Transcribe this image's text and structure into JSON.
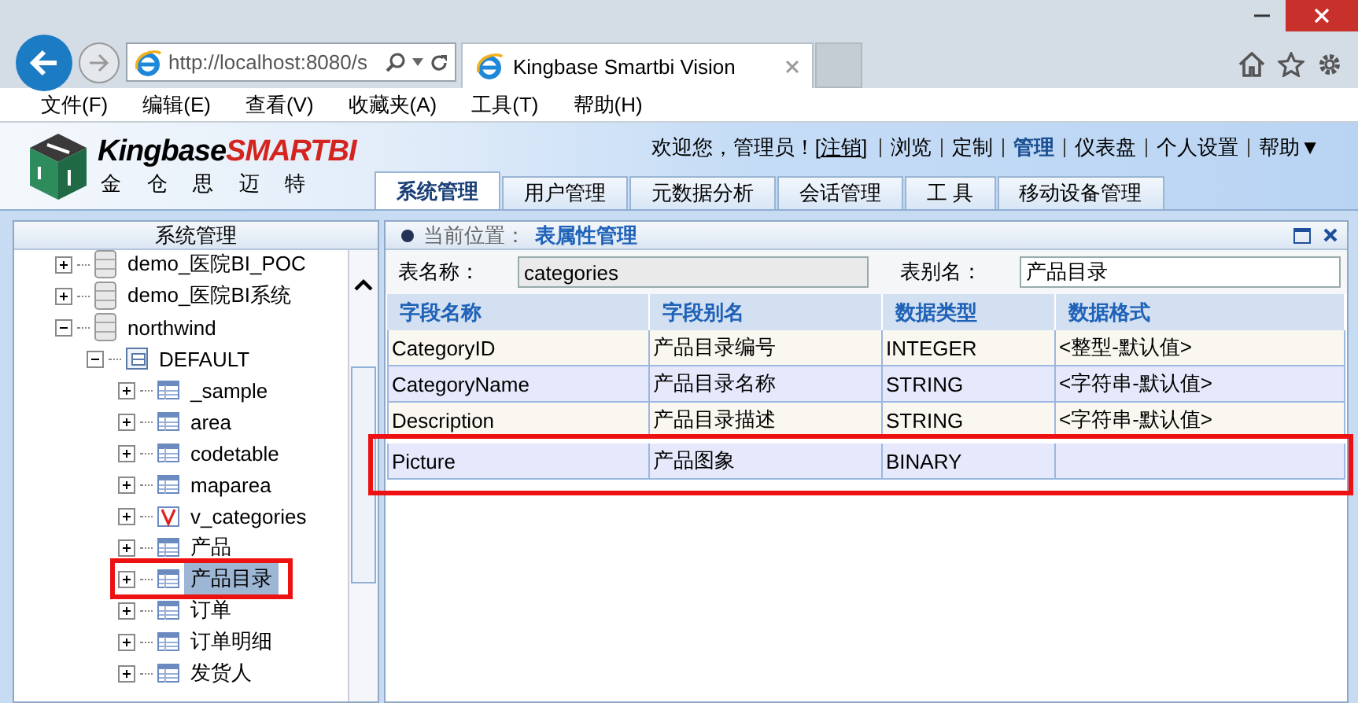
{
  "browser": {
    "address": "http://localhost:8080/s",
    "tab_title": "Kingbase Smartbi Vision",
    "menu": [
      "文件(F)",
      "编辑(E)",
      "查看(V)",
      "收藏夹(A)",
      "工具(T)",
      "帮助(H)"
    ]
  },
  "header": {
    "logo_name": "Kingbase",
    "logo_brand": "SMARTBI",
    "logo_subtitle": [
      "金",
      "仓",
      "思",
      "迈",
      "特"
    ],
    "greeting": "欢迎您，管理员！[",
    "logout": "注销",
    "greeting_end": "]",
    "nav_links": [
      {
        "label": "浏览",
        "selected": false
      },
      {
        "label": "定制",
        "selected": false
      },
      {
        "label": "管理",
        "selected": true
      },
      {
        "label": "仪表盘",
        "selected": false
      },
      {
        "label": "个人设置",
        "selected": false
      },
      {
        "label": "帮助▼",
        "selected": false
      }
    ],
    "tabs": [
      {
        "label": "系统管理",
        "selected": true
      },
      {
        "label": "用户管理",
        "selected": false
      },
      {
        "label": "元数据分析",
        "selected": false
      },
      {
        "label": "会话管理",
        "selected": false
      },
      {
        "label": "工 具",
        "selected": false
      },
      {
        "label": "移动设备管理",
        "selected": false
      }
    ]
  },
  "sidebar": {
    "title": "系统管理",
    "tree": [
      {
        "label": "demo_医院BI_POC",
        "kind": "database",
        "expanded": false,
        "selected": false,
        "highlighted": false
      },
      {
        "label": "demo_医院BI系统",
        "kind": "database",
        "expanded": false,
        "selected": false,
        "highlighted": false
      },
      {
        "label": "northwind",
        "kind": "database",
        "expanded": true,
        "selected": false,
        "highlighted": false,
        "children": [
          {
            "label": "DEFAULT",
            "kind": "schema",
            "expanded": true,
            "selected": false,
            "highlighted": false,
            "children": [
              {
                "label": "_sample",
                "kind": "table",
                "expanded": false,
                "selected": false,
                "highlighted": false
              },
              {
                "label": "area",
                "kind": "table",
                "expanded": false,
                "selected": false,
                "highlighted": false
              },
              {
                "label": "codetable",
                "kind": "table",
                "expanded": false,
                "selected": false,
                "highlighted": false
              },
              {
                "label": "maparea",
                "kind": "table",
                "expanded": false,
                "selected": false,
                "highlighted": false
              },
              {
                "label": "v_categories",
                "kind": "view",
                "expanded": false,
                "selected": false,
                "highlighted": false
              },
              {
                "label": "产品",
                "kind": "table",
                "expanded": false,
                "selected": false,
                "highlighted": false
              },
              {
                "label": "产品目录",
                "kind": "table",
                "expanded": false,
                "selected": true,
                "highlighted": true
              },
              {
                "label": "订单",
                "kind": "table",
                "expanded": false,
                "selected": false,
                "highlighted": false
              },
              {
                "label": "订单明细",
                "kind": "table",
                "expanded": false,
                "selected": false,
                "highlighted": false
              },
              {
                "label": "发货人",
                "kind": "table",
                "expanded": false,
                "selected": false,
                "highlighted": false
              }
            ]
          }
        ]
      }
    ]
  },
  "panel": {
    "location_label": "当前位置：",
    "location": "表属性管理",
    "fields": [
      {
        "label": "表名称：",
        "value": "categories",
        "disabled": true
      },
      {
        "label": "表别名：",
        "value": "产品目录",
        "disabled": false
      }
    ],
    "table": {
      "columns": [
        "字段名称",
        "字段别名",
        "数据类型",
        "数据格式"
      ],
      "rows": [
        {
          "cells": [
            "CategoryID",
            "产品目录编号",
            "INTEGER",
            "<整型-默认值>"
          ],
          "highlighted": false
        },
        {
          "cells": [
            "CategoryName",
            "产品目录名称",
            "STRING",
            "<字符串-默认值>"
          ],
          "highlighted": false
        },
        {
          "cells": [
            "Description",
            "产品目录描述",
            "STRING",
            "<字符串-默认值>"
          ],
          "highlighted": false
        },
        {
          "cells": [
            "Picture",
            "产品图象",
            "BINARY",
            ""
          ],
          "highlighted": true
        }
      ]
    }
  }
}
